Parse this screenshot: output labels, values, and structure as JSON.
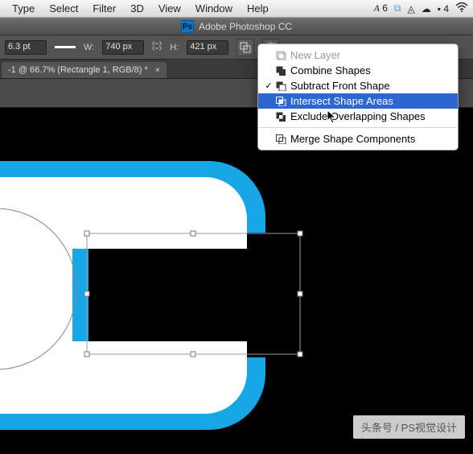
{
  "menubar": {
    "items": [
      "Type",
      "Select",
      "Filter",
      "3D",
      "View",
      "Window",
      "Help"
    ],
    "right": {
      "label_a6": "A 6",
      "star": "✦",
      "cloud": "☁",
      "drive": "▲",
      "cc": "◎",
      "battery_icon": "▮",
      "wifi": "4"
    }
  },
  "titlebar": {
    "app_name": "Adobe Photoshop CC",
    "ps": "Ps"
  },
  "options": {
    "stroke_pt": "6.3 pt",
    "w_label": "W:",
    "w_value": "740 px",
    "h_label": "H:",
    "h_value": "421 px"
  },
  "doc_tab": {
    "title": "-1 @ 66.7% (Rectangle 1, RGB/8) *",
    "close": "×"
  },
  "context_menu": {
    "items": [
      {
        "label": "New Layer",
        "disabled": true,
        "checked": false,
        "icon": "new-layer"
      },
      {
        "label": "Combine Shapes",
        "disabled": false,
        "checked": false,
        "icon": "combine"
      },
      {
        "label": "Subtract Front Shape",
        "disabled": false,
        "checked": true,
        "icon": "subtract"
      },
      {
        "label": "Intersect Shape Areas",
        "disabled": false,
        "checked": false,
        "icon": "intersect",
        "highlight": true
      },
      {
        "label": "Exclude Overlapping Shapes",
        "disabled": false,
        "checked": false,
        "icon": "exclude"
      }
    ],
    "merge_label": "Merge Shape Components",
    "merge_icon": "merge"
  },
  "watermark": {
    "text": "头条号 / PS视觉设计"
  },
  "colors": {
    "accent": "#18a7e6",
    "menu_highlight": "#2b66d1"
  }
}
